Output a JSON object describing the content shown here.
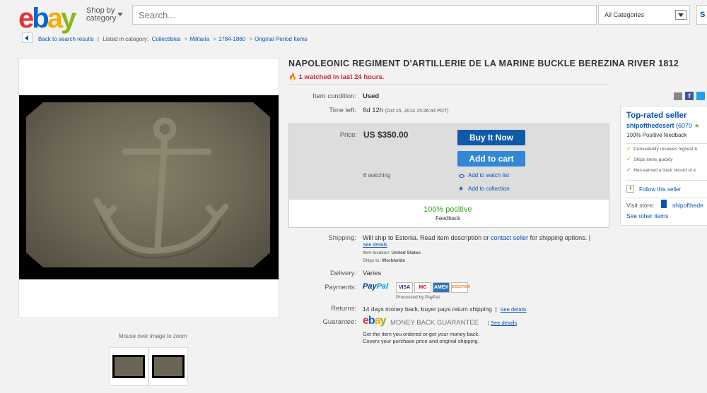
{
  "header": {
    "logo": [
      "e",
      "b",
      "a",
      "y"
    ],
    "shop_by": "Shop by",
    "category": "category",
    "search_placeholder": "Search...",
    "all_categories": "All Categories",
    "search_button": "S"
  },
  "breadcrumb": {
    "back": "Back to search results",
    "listed_in": "Listed in category:",
    "items": [
      "Collectibles",
      "Militaria",
      "1784-1860",
      "Original Period Items"
    ]
  },
  "image": {
    "zoom_hint": "Mouse over image to zoom"
  },
  "item": {
    "title": "NAPOLEONIC REGIMENT D'ARTILLERIE DE LA MARINE BUCKLE BEREZINA RIVER 1812",
    "watched": "1 watched in last 24 hours.",
    "condition_label": "Item condition:",
    "condition": "Used",
    "time_left_label": "Time left:",
    "time_left": "6d 12h",
    "end_time": "(Oct 15, 2014   15:26:44 PDT)",
    "price_label": "Price:",
    "price": "US $350.00",
    "buy_now": "Buy It Now",
    "add_to_cart": "Add to cart",
    "watching": "6 watching",
    "add_watch": "Add to watch list",
    "add_collection": "Add to collection",
    "positive": "100% positive",
    "feedback": "Feedback",
    "shipping_label": "Shipping:",
    "shipping_text": "Will ship to Estonia. Read item description or",
    "contact_seller": "contact seller",
    "shipping_text2": "for shipping options. |",
    "see_details": "See details",
    "item_location_label": "Item location:",
    "item_location": "United States",
    "ships_to_label": "Ships to:",
    "ships_to": "Worldwide",
    "delivery_label": "Delivery:",
    "delivery": "Varies",
    "payments_label": "Payments:",
    "paypal_a": "Pay",
    "paypal_b": "Pal",
    "cards": [
      "VISA",
      "MC",
      "AMEX",
      "DISCOVER"
    ],
    "processed_by": "Processed by PayPal",
    "returns_label": "Returns:",
    "returns": "14 days money back, buyer pays return shipping",
    "returns_see_details": "See details",
    "guarantee_label": "Guarantee:",
    "mbg_logo": [
      "e",
      "b",
      "a",
      "y"
    ],
    "mbg_text": "MONEY BACK GUARANTEE",
    "guarantee_see_details": "See details",
    "guarantee_line1": "Get the item you ordered or get your money back.",
    "guarantee_line2": "Covers your purchase price and original shipping."
  },
  "seller": {
    "top_rated": "Top-rated seller",
    "name": "shipofthedesert",
    "score": "(6070",
    "positive": "100% Positive feedback",
    "points": [
      "Consistently receives highest b",
      "Ships items quickly",
      "Has earned a track record of e"
    ],
    "follow": "Follow this seller",
    "visit_store_label": "Visit store:",
    "store_name": "shipofthede",
    "see_other": "See other items"
  },
  "colors": {
    "buy_button": "#0f5aa8",
    "cart_button": "#3287d7",
    "positive_green": "#2fa21a",
    "watched_red": "#dd1e31"
  }
}
